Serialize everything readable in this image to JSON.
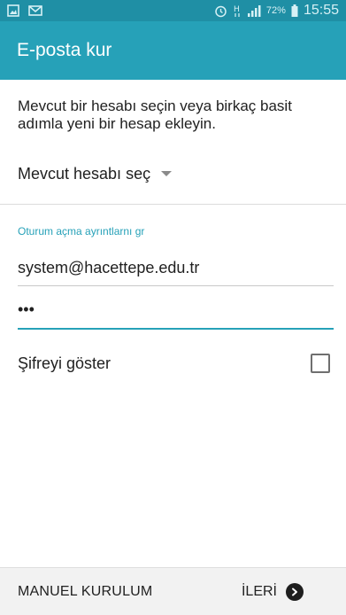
{
  "status_bar": {
    "left_icons": [
      "gallery-icon",
      "mail-icon"
    ],
    "right_icons": [
      "alarm-icon",
      "network-h-icon",
      "signal-icon",
      "battery-icon"
    ],
    "battery": "72%",
    "time": "15:55"
  },
  "app_bar": {
    "title": "E-posta kur"
  },
  "intro_text": "Mevcut bir hesabı seçin veya birkaç basit adımla yeni bir hesap ekleyin.",
  "account_select": {
    "label": "Mevcut hesabı seç"
  },
  "login_section": {
    "label": "Oturum açma ayrıntlarnı gr",
    "email_value": "system@hacettepe.edu.tr",
    "password_value": "•••"
  },
  "show_password": {
    "label": "Şifreyi göster",
    "checked": false
  },
  "bottom_bar": {
    "manual_label": "MANUEL KURULUM",
    "next_label": "İLERİ"
  },
  "colors": {
    "status_bar": "#1f8fa5",
    "app_bar": "#26a1b8",
    "accent": "#26a1b8"
  }
}
